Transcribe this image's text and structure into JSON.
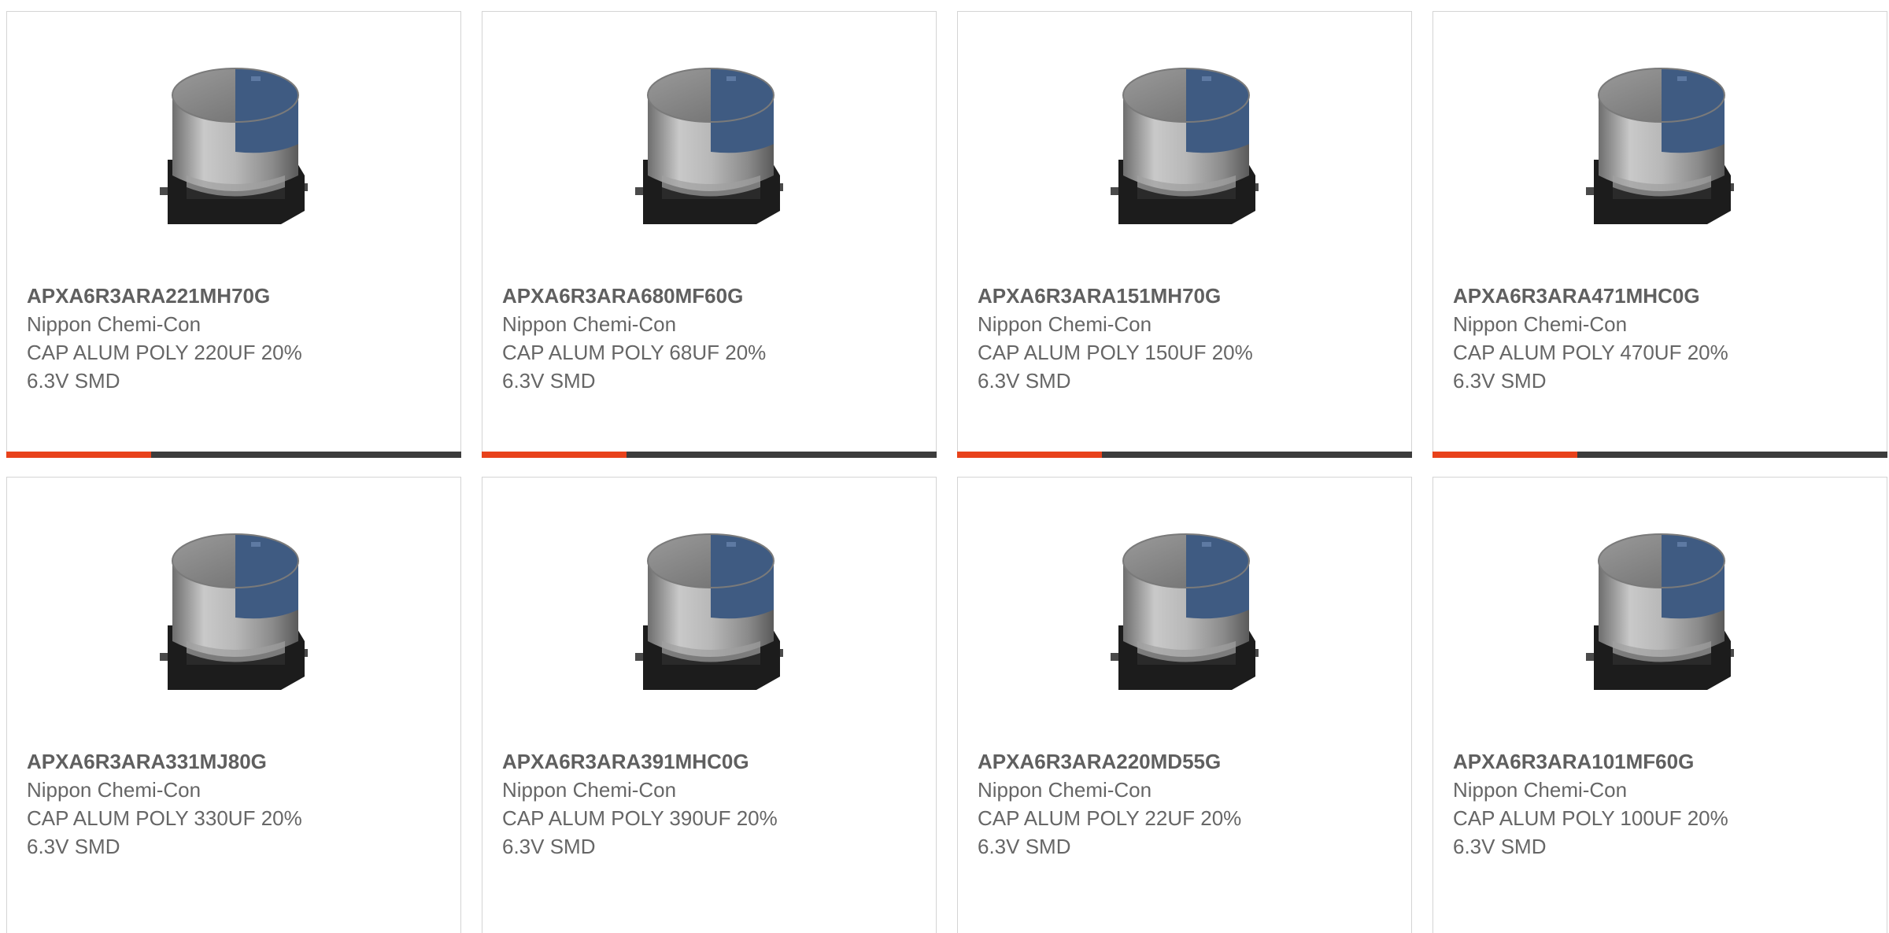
{
  "colors": {
    "accent": "#e8421b",
    "bar": "#3c3c3c",
    "text": "#666666",
    "border": "#d4d4d4",
    "capacitor_stripe": "#3f5b82"
  },
  "products": [
    {
      "part_number": "APXA6R3ARA221MH70G",
      "manufacturer": "Nippon Chemi-Con",
      "description": "CAP ALUM POLY 220UF 20%\n6.3V SMD",
      "image_icon": "capacitor-image"
    },
    {
      "part_number": "APXA6R3ARA680MF60G",
      "manufacturer": "Nippon Chemi-Con",
      "description": "CAP ALUM POLY 68UF 20%\n6.3V SMD",
      "image_icon": "capacitor-image"
    },
    {
      "part_number": "APXA6R3ARA151MH70G",
      "manufacturer": "Nippon Chemi-Con",
      "description": "CAP ALUM POLY 150UF 20%\n6.3V SMD",
      "image_icon": "capacitor-image"
    },
    {
      "part_number": "APXA6R3ARA471MHC0G",
      "manufacturer": "Nippon Chemi-Con",
      "description": "CAP ALUM POLY 470UF 20%\n6.3V SMD",
      "image_icon": "capacitor-image"
    },
    {
      "part_number": "APXA6R3ARA331MJ80G",
      "manufacturer": "Nippon Chemi-Con",
      "description": "CAP ALUM POLY 330UF 20%\n6.3V SMD",
      "image_icon": "capacitor-image"
    },
    {
      "part_number": "APXA6R3ARA391MHC0G",
      "manufacturer": "Nippon Chemi-Con",
      "description": "CAP ALUM POLY 390UF 20%\n6.3V SMD",
      "image_icon": "capacitor-image"
    },
    {
      "part_number": "APXA6R3ARA220MD55G",
      "manufacturer": "Nippon Chemi-Con",
      "description": "CAP ALUM POLY 22UF 20%\n6.3V SMD",
      "image_icon": "capacitor-image"
    },
    {
      "part_number": "APXA6R3ARA101MF60G",
      "manufacturer": "Nippon Chemi-Con",
      "description": "CAP ALUM POLY 100UF 20%\n6.3V SMD",
      "image_icon": "capacitor-image"
    }
  ]
}
